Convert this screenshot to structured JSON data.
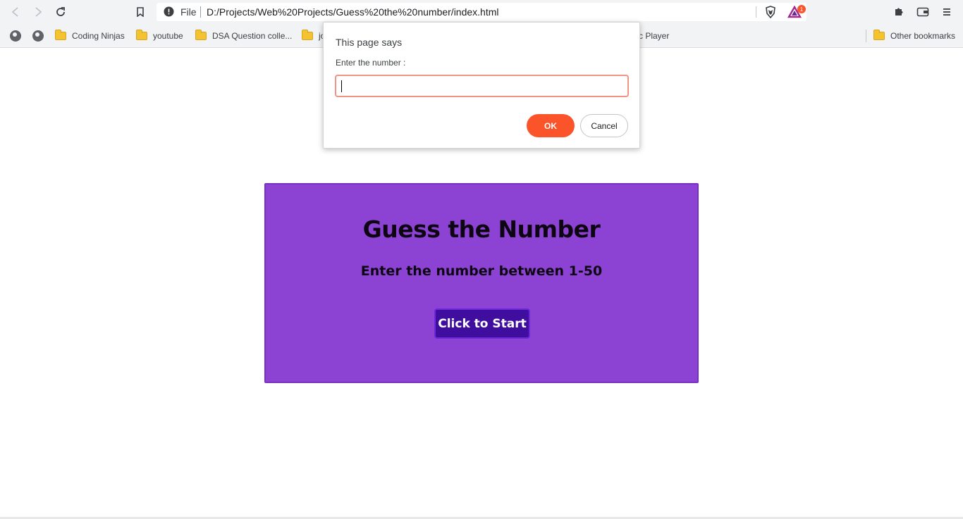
{
  "browser": {
    "address": {
      "scheme_label": "File",
      "url": "D:/Projects/Web%20Projects/Guess%20the%20number/index.html"
    },
    "extensions": {
      "brave_badge": "1"
    },
    "bookmarks": [
      {
        "label": "Coding Ninjas"
      },
      {
        "label": "youtube"
      },
      {
        "label": "DSA Question colle..."
      },
      {
        "label": "jo"
      },
      {
        "label": "c Player"
      },
      {
        "label": "Other bookmarks"
      }
    ]
  },
  "page": {
    "title": "Guess the Number",
    "subtitle": "Enter the number between 1-50",
    "start_label": "Click to Start",
    "colors": {
      "card": "#8c43d4",
      "button": "#3f0e9f"
    }
  },
  "dialog": {
    "heading": "This page says",
    "message": "Enter the number :",
    "input_value": "",
    "ok_label": "OK",
    "cancel_label": "Cancel",
    "colors": {
      "ok": "#fb542b",
      "input_border": "#f39383"
    }
  }
}
